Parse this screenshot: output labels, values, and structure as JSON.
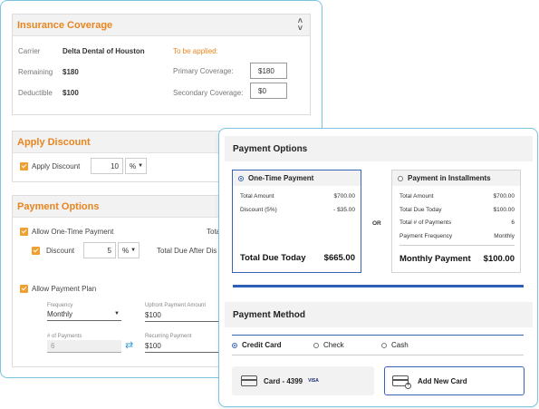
{
  "insurance": {
    "title": "Insurance Coverage",
    "carrier_label": "Carrier",
    "carrier_value": "Delta Dental of Houston",
    "to_be_applied": "To be applied:",
    "remaining_label": "Remaining",
    "remaining_value": "$180",
    "deductible_label": "Deductible",
    "deductible_value": "$100",
    "primary_label": "Primary Coverage:",
    "primary_value": "$180",
    "secondary_label": "Secondary Coverage:",
    "secondary_value": "$0"
  },
  "discount": {
    "title": "Apply Discount",
    "checkbox_label": "Apply Discount",
    "amount": "10",
    "unit": "%"
  },
  "back_payment": {
    "title": "Payment Options",
    "one_time_label": "Allow One-Time Payment",
    "total_cut": "Tota",
    "discount_label": "Discount",
    "discount_amount": "5",
    "discount_unit": "%",
    "total_after_label": "Total Due After Dis",
    "payment_plan_label": "Allow Payment Plan",
    "frequency_label": "Frequency",
    "frequency_value": "Monthly",
    "upfront_label": "Upfront Payment Amount",
    "upfront_value": "$100",
    "num_payments_label": "# of Payments",
    "num_payments_value": "6",
    "recurring_label": "Recurring Payment",
    "recurring_value": "$100"
  },
  "front": {
    "payment_options_title": "Payment Options",
    "or_label": "OR",
    "one_time": {
      "title": "One-Time Payment",
      "rows": [
        {
          "label": "Total Amount",
          "value": "$700.00"
        },
        {
          "label": "Discount (5%)",
          "value": "- $35.00"
        }
      ],
      "total_label": "Total Due Today",
      "total_value": "$665.00"
    },
    "installments": {
      "title": "Payment in Installments",
      "rows": [
        {
          "label": "Total Amount",
          "value": "$700.00"
        },
        {
          "label": "Total Due Today",
          "value": "$100.00"
        },
        {
          "label": "Total # of Payments",
          "value": "6"
        },
        {
          "label": "Payment Frequency",
          "value": "Monthly"
        }
      ],
      "total_label": "Monthly Payment",
      "total_value": "$100.00"
    },
    "payment_method_title": "Payment Method",
    "methods": [
      "Credit Card",
      "Check",
      "Cash"
    ],
    "saved_card": "Card - 4399",
    "card_brand": "VISA",
    "add_card": "Add New Card"
  },
  "colors": {
    "accent_orange": "#e8851e",
    "accent_blue": "#2d5fb8",
    "border_cyan": "#7cc4e0"
  }
}
